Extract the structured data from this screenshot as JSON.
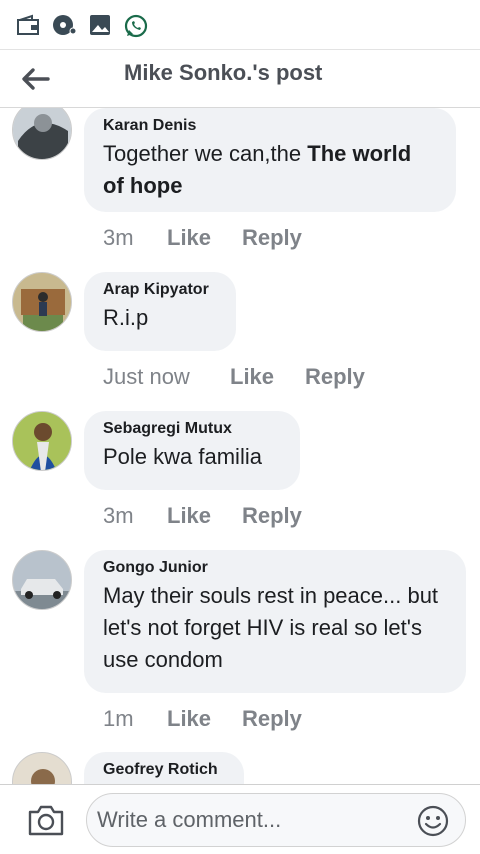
{
  "status_bar": {
    "icons": [
      "wallet-icon",
      "disc-icon",
      "gallery-icon",
      "whatsapp-icon"
    ]
  },
  "header": {
    "title": "Mike Sonko.'s post",
    "back_icon": "arrow-left-icon"
  },
  "comments": [
    {
      "author": "Karan Denis",
      "text_plain": "Together we can,the ",
      "text_bold": "The world of hope",
      "time": "3m",
      "like": "Like",
      "reply": "Reply"
    },
    {
      "author": "Arap Kipyator",
      "text": "R.i.p",
      "time": "Just now",
      "like": "Like",
      "reply": "Reply"
    },
    {
      "author": "Sebagregi Mutux",
      "text": "Pole kwa familia",
      "time": "3m",
      "like": "Like",
      "reply": "Reply"
    },
    {
      "author": "Gongo Junior",
      "text": "May their souls rest in peace... but let's not forget HIV is real so let's use condom",
      "time": "1m",
      "like": "Like",
      "reply": "Reply"
    },
    {
      "author": "Geofrey Rotich"
    }
  ],
  "composer": {
    "placeholder": "Write a comment...",
    "camera_icon": "camera-icon",
    "emoji_icon": "smiley-icon"
  },
  "colors": {
    "bubble": "#f0f2f5",
    "meta": "#7f8389",
    "title": "#4b4f56"
  }
}
